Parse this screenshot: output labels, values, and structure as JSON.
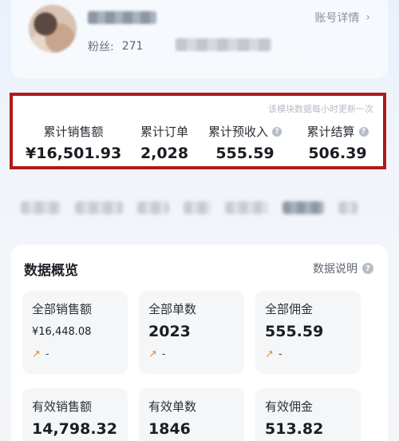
{
  "profile": {
    "account_detail_label": "账号详情",
    "fans_label": "粉丝:",
    "fans_count": "271"
  },
  "stats": {
    "update_note": "该模块数据每小时更新一次",
    "items": [
      {
        "label": "累计销售额",
        "value": "¥16,501.93"
      },
      {
        "label": "累计订单",
        "value": "2,028"
      },
      {
        "label": "累计预收入",
        "value": "555.59"
      },
      {
        "label": "累计结算",
        "value": "506.39"
      }
    ]
  },
  "overview": {
    "title": "数据概览",
    "help_label": "数据说明",
    "tiles": [
      {
        "label": "全部销售额",
        "value": "¥16,448.08",
        "trend": "-"
      },
      {
        "label": "全部单数",
        "value": "2023",
        "trend": "-"
      },
      {
        "label": "全部佣金",
        "value": "555.59",
        "trend": "-"
      },
      {
        "label": "有效销售额",
        "value": "14,798.32"
      },
      {
        "label": "有效单数",
        "value": "1846"
      },
      {
        "label": "有效佣金",
        "value": "513.82"
      }
    ]
  },
  "icons": {
    "chevron": "chevron-right-icon",
    "help": "question-circle-icon",
    "trend": "trend-up-icon"
  }
}
